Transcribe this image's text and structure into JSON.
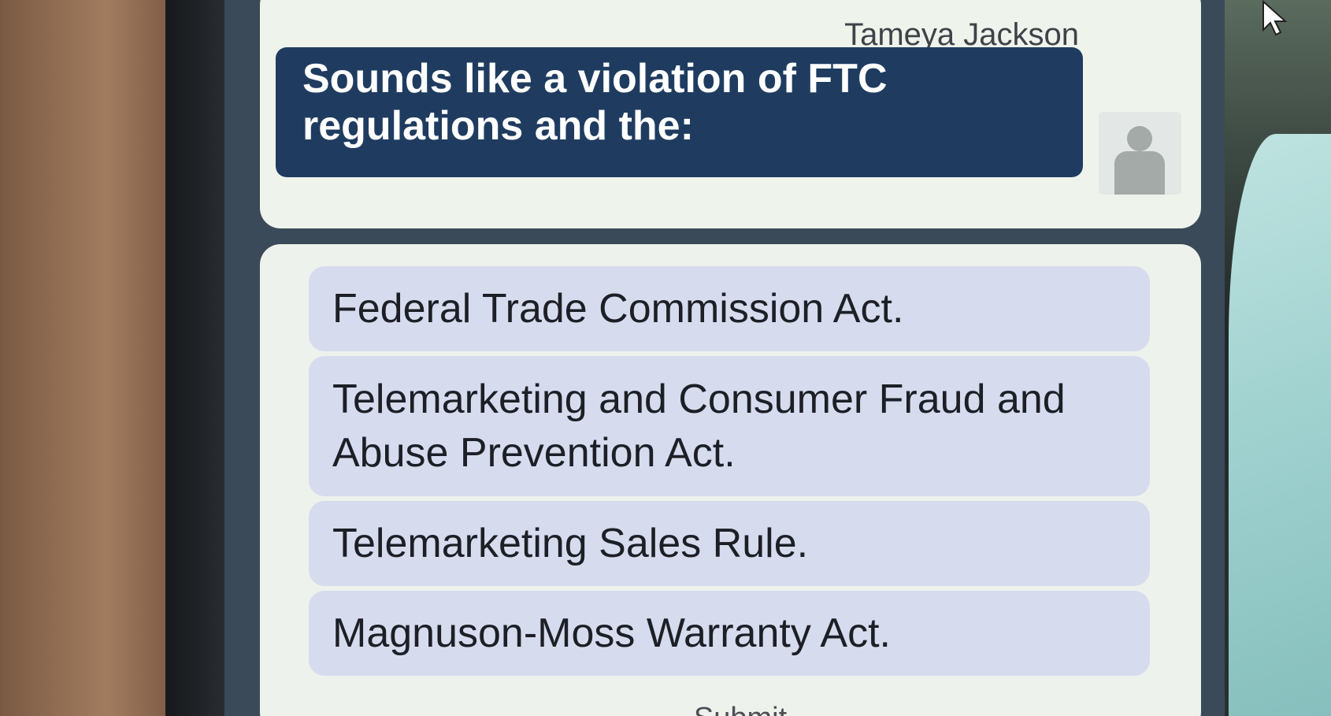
{
  "chat": {
    "sender_name": "Tameya Jackson",
    "message": "Sounds like a violation of FTC regulations and the:"
  },
  "options": [
    {
      "label": "Federal Trade Commission Act."
    },
    {
      "label": "Telemarketing and Consumer Fraud and Abuse Prevention Act."
    },
    {
      "label": "Telemarketing Sales Rule."
    },
    {
      "label": "Magnuson-Moss Warranty Act."
    }
  ],
  "submit_label": "Submit",
  "icons": {
    "avatar": "person-icon",
    "cursor": "mouse-pointer-icon"
  },
  "colors": {
    "bubble": "#1f3c60",
    "option_background": "#d7dbee",
    "card_background": "#eef3ec",
    "frame": "#3b4a58"
  }
}
